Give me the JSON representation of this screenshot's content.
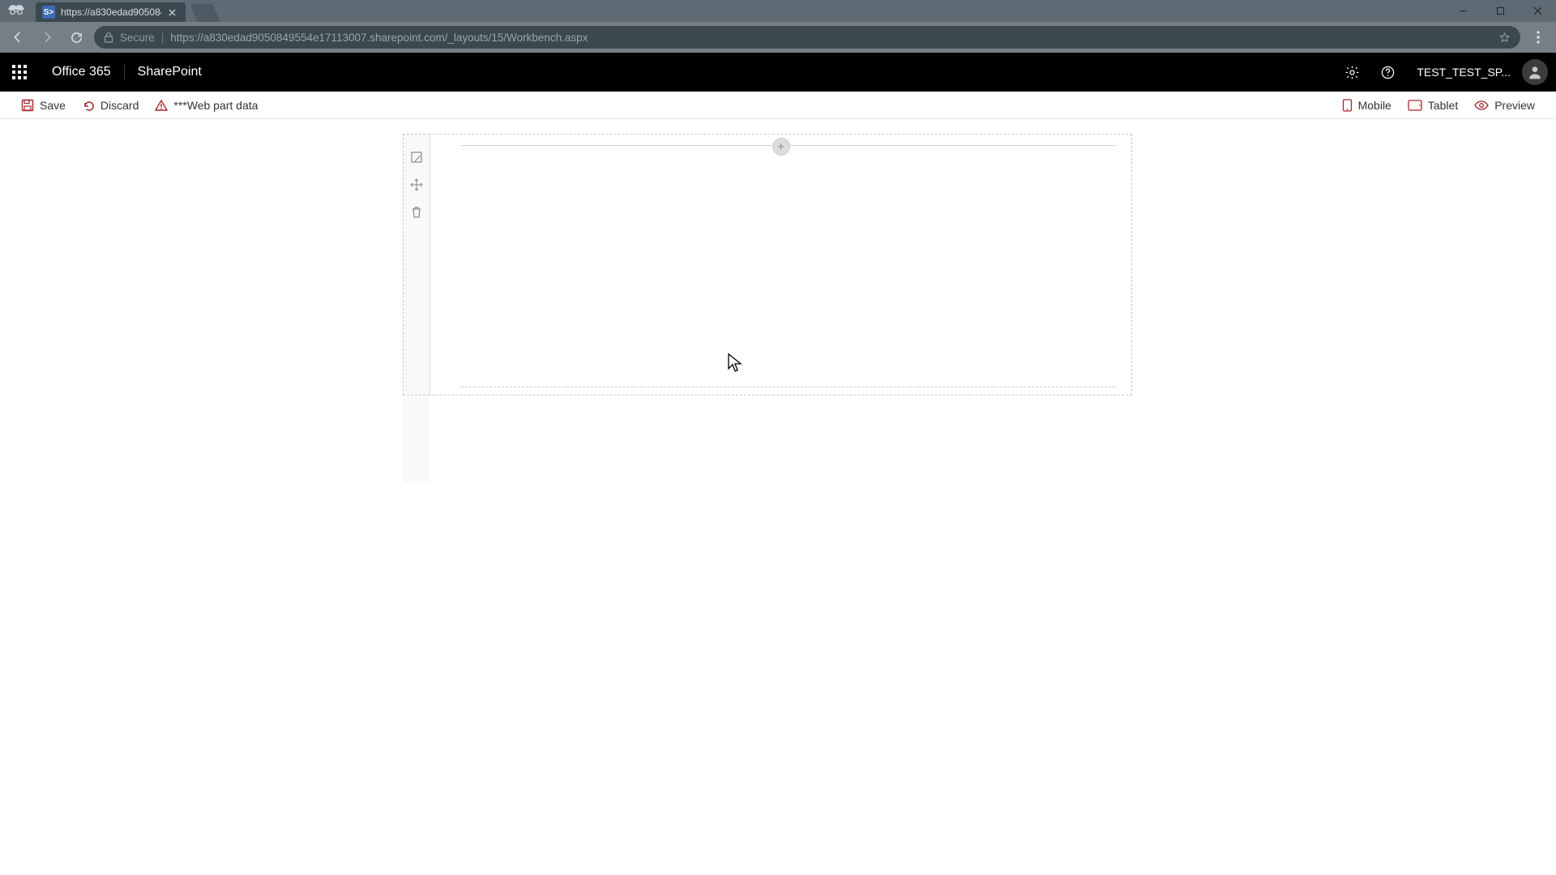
{
  "browser": {
    "tab_title": "https://a830edad905084",
    "secure_label": "Secure",
    "url_host": "https://a830edad9050849554e17113007.sharepoint.com",
    "url_path": "/_layouts/15/Workbench.aspx"
  },
  "suitebar": {
    "app_launcher": "App launcher",
    "office": "Office 365",
    "product": "SharePoint",
    "user_display": "TEST_TEST_SP..."
  },
  "commandbar": {
    "save": "Save",
    "discard": "Discard",
    "webpartdata": "***Web part data",
    "mobile": "Mobile",
    "tablet": "Tablet",
    "preview": "Preview"
  },
  "canvas": {
    "add_hint": "+"
  }
}
